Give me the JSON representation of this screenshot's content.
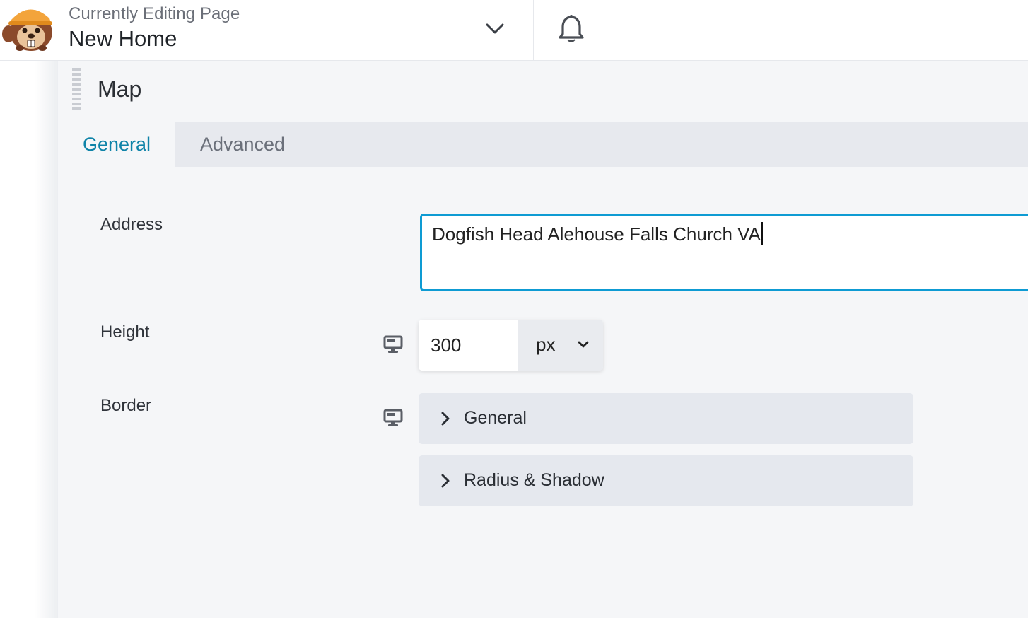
{
  "header": {
    "editing_label": "Currently Editing Page",
    "page_name": "New Home",
    "logo_icon": "beaver-logo-icon",
    "switcher_icon": "chevron-down-icon",
    "notifications_icon": "bell-icon"
  },
  "panel": {
    "title": "Map",
    "tabs": [
      {
        "label": "General",
        "active": true
      },
      {
        "label": "Advanced",
        "active": false
      }
    ]
  },
  "fields": {
    "address": {
      "label": "Address",
      "value": "Dogfish Head Alehouse Falls Church VA"
    },
    "height": {
      "label": "Height",
      "value": "300",
      "unit": "px",
      "device_icon": "desktop-icon"
    },
    "border": {
      "label": "Border",
      "device_icon": "desktop-icon",
      "sections": [
        {
          "label": "General"
        },
        {
          "label": "Radius & Shadow"
        }
      ]
    }
  },
  "colors": {
    "accent": "#0e83a8",
    "focus_border": "#0e9bd3",
    "panel_bg": "#f5f6f8",
    "tab_bar_bg": "#e7e9ee",
    "accordion_bg": "#e5e8ee"
  }
}
